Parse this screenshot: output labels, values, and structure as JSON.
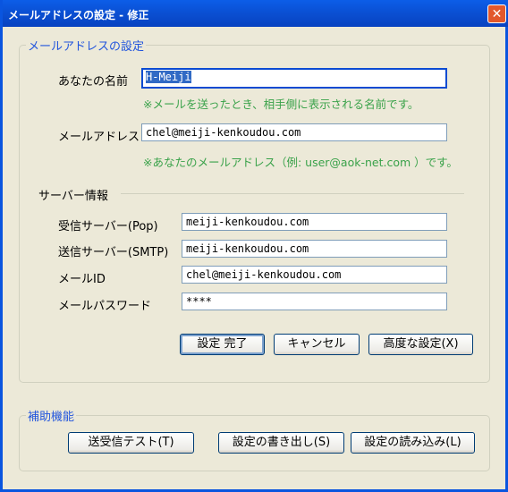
{
  "window": {
    "title": "メールアドレスの設定 - 修正",
    "close_glyph": "✕"
  },
  "mail_group": {
    "title": "メールアドレスの設定",
    "name_label": "あなたの名前",
    "name_value": "H-Meiji",
    "name_hint": "※メールを送ったとき、相手側に表示される名前です。",
    "address_label": "メールアドレス",
    "address_value": "chel@meiji-kenkoudou.com",
    "address_hint": "※あなたのメールアドレス（例: user@aok-net.com ）です。"
  },
  "server": {
    "title": "サーバー情報",
    "pop_label": "受信サーバー(Pop)",
    "pop_value": "meiji-kenkoudou.com",
    "smtp_label": "送信サーバー(SMTP)",
    "smtp_value": "meiji-kenkoudou.com",
    "id_label": "メールID",
    "id_value": "chel@meiji-kenkoudou.com",
    "password_label": "メールパスワード",
    "password_value": "****"
  },
  "actions": {
    "complete": "設定 完了",
    "cancel": "キャンセル",
    "advanced": "高度な設定(X)"
  },
  "aux_group": {
    "title": "補助機能",
    "test": "送受信テスト(T)",
    "export": "設定の書き出し(S)",
    "import": "設定の読み込み(L)"
  }
}
